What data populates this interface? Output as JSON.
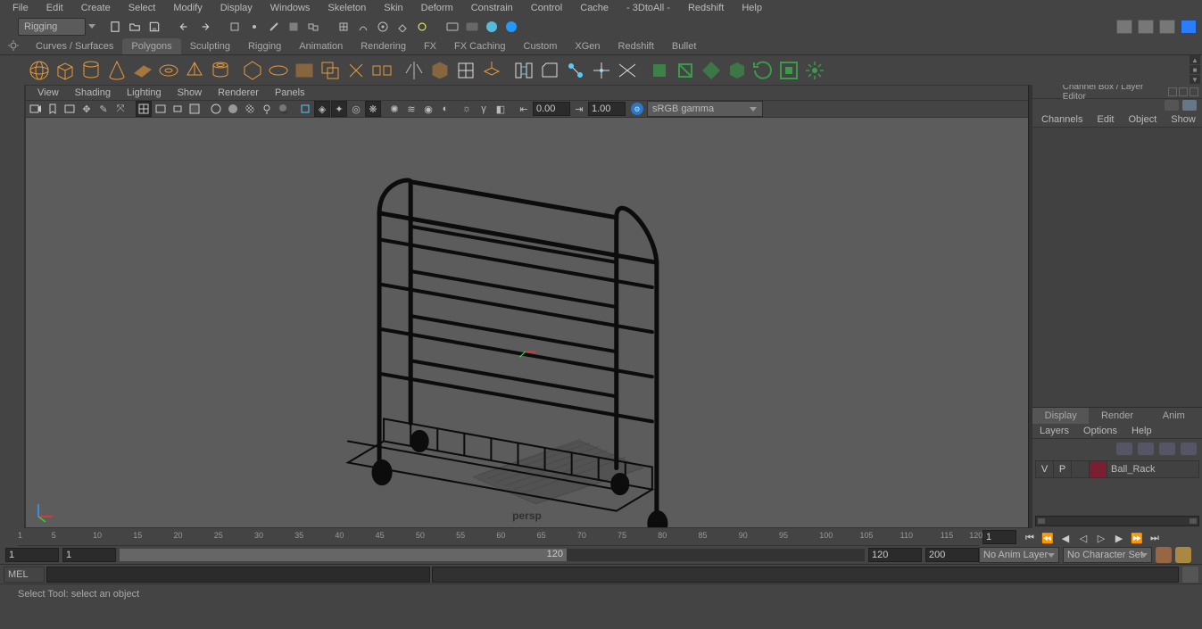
{
  "menu": {
    "items": [
      "File",
      "Edit",
      "Create",
      "Select",
      "Modify",
      "Display",
      "Windows",
      "Skeleton",
      "Skin",
      "Deform",
      "Constrain",
      "Control",
      "Cache",
      "- 3DtoAll -",
      "Redshift",
      "Help"
    ]
  },
  "workspace": {
    "current": "Rigging"
  },
  "shelf_tabs": {
    "items": [
      "Curves / Surfaces",
      "Polygons",
      "Sculpting",
      "Rigging",
      "Animation",
      "Rendering",
      "FX",
      "FX Caching",
      "Custom",
      "XGen",
      "Redshift",
      "Bullet"
    ],
    "active_index": 1
  },
  "panel_menu": {
    "items": [
      "View",
      "Shading",
      "Lighting",
      "Show",
      "Renderer",
      "Panels"
    ]
  },
  "panel_toolbar": {
    "near": "0.00",
    "far": "1.00",
    "colorspace": "sRGB gamma"
  },
  "viewport": {
    "camera": "persp"
  },
  "channel_box": {
    "title": "Channel Box / Layer Editor",
    "menu": [
      "Channels",
      "Edit",
      "Object",
      "Show"
    ],
    "tabs": [
      "Display",
      "Render",
      "Anim"
    ],
    "active_tab_index": 0,
    "layer_menu": [
      "Layers",
      "Options",
      "Help"
    ],
    "layers": [
      {
        "vis": "V",
        "play": "P",
        "name": "Ball_Rack"
      }
    ]
  },
  "time": {
    "ticks": [
      "1",
      "5",
      "10",
      "15",
      "20",
      "25",
      "30",
      "35",
      "40",
      "45",
      "50",
      "55",
      "60",
      "65",
      "70",
      "75",
      "80",
      "85",
      "90",
      "95",
      "100",
      "105",
      "110",
      "115",
      "120"
    ],
    "start_outer": "1",
    "start_inner": "1",
    "end_inner": "120",
    "end_outer": "200",
    "range_end_field": "120",
    "cur_frame": "1"
  },
  "anim": {
    "layer": "No Anim Layer",
    "charset": "No Character Set"
  },
  "cmd": {
    "lang": "MEL"
  },
  "help": {
    "text": "Select Tool: select an object"
  }
}
